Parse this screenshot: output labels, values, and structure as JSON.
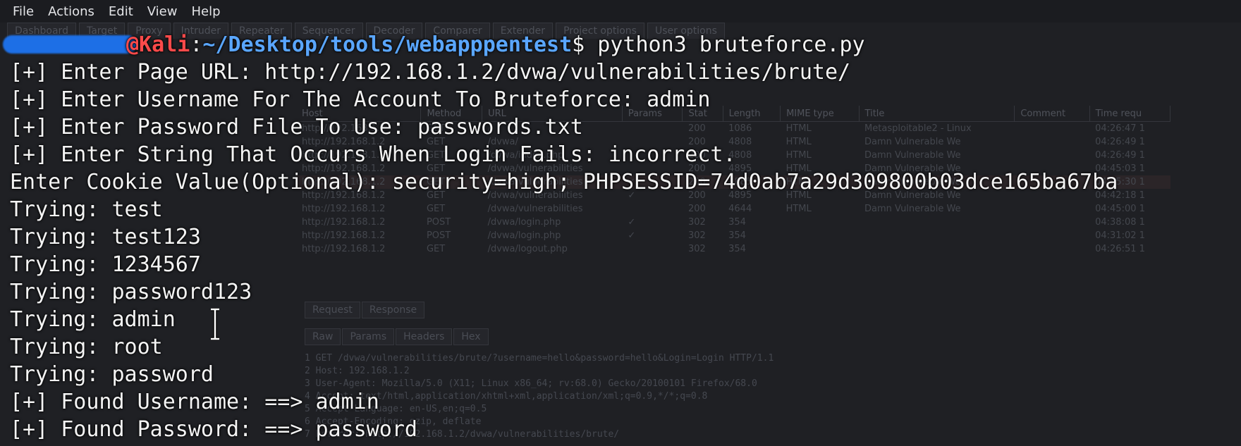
{
  "menubar": {
    "items": [
      "File",
      "Actions",
      "Edit",
      "View",
      "Help"
    ]
  },
  "terminal": {
    "prompt": {
      "user": "@Kali",
      "separator": ":",
      "path": "~/Desktop/tools/webapppentest",
      "symbol": "$",
      "command": "python3 bruteforce.py"
    },
    "lines": [
      "[+] Enter Page URL: http://192.168.1.2/dvwa/vulnerabilities/brute/",
      "[+] Enter Username For The Account To Bruteforce: admin",
      "[+] Enter Password File To Use: passwords.txt",
      "[+] Enter String That Occurs When Login Fails: incorrect.",
      "Enter Cookie Value(Optional): security=high; PHPSESSID=74d0ab7a29d309800b03dce165ba67ba",
      "Trying: test",
      "Trying: test123",
      "Trying: 1234567",
      "Trying: password123",
      "Trying: admin",
      "Trying: root",
      "Trying: password",
      "[+] Found Username: ==> admin",
      "[+] Found Password: ==> password"
    ]
  },
  "background_app": {
    "tabs": [
      "Dashboard",
      "Target",
      "Proxy",
      "Intruder",
      "Repeater",
      "Sequencer",
      "Decoder",
      "Comparer",
      "Extender",
      "Project options",
      "User options"
    ],
    "table_headers": [
      "Host",
      "Method",
      "URL",
      "Params",
      "Stat",
      "Length",
      "MIME type",
      "Title",
      "Comment",
      "Time requ"
    ],
    "table_rows": [
      [
        "http://192.168.1.2",
        "GET",
        "/",
        "",
        "200",
        "1086",
        "HTML",
        "Metasploitable2 - Linux",
        "",
        "04:26:47 1"
      ],
      [
        "http://192.168.1.2",
        "GET",
        "/dvwa/",
        "",
        "200",
        "4808",
        "HTML",
        "Damn Vulnerable We",
        "",
        "04:26:49 1"
      ],
      [
        "http://192.168.1.2",
        "GET",
        "/dvwa/index.php",
        "",
        "200",
        "4808",
        "HTML",
        "Damn Vulnerable We",
        "",
        "04:26:49 1"
      ],
      [
        "http://192.168.1.2",
        "GET",
        "/dvwa/vulnerabilities",
        "",
        "200",
        "4895",
        "HTML",
        "Damn Vulnerable We",
        "",
        "04:45:03 1"
      ],
      [
        "http://192.168.1.2",
        "GET",
        "/dvwa/vulnerabilities",
        "✓",
        "200",
        "4885",
        "HTML",
        "Damn Vulnerable We",
        "",
        "04:45:30 1"
      ],
      [
        "http://192.168.1.2",
        "GET",
        "/dvwa/vulnerabilities",
        "✓",
        "200",
        "4895",
        "HTML",
        "Damn Vulnerable We",
        "",
        "04:42:18 1"
      ],
      [
        "http://192.168.1.2",
        "GET",
        "/dvwa/vulnerabilities",
        "",
        "200",
        "4644",
        "HTML",
        "Damn Vulnerable We",
        "",
        "04:45:00 1"
      ],
      [
        "http://192.168.1.2",
        "POST",
        "/dvwa/login.php",
        "✓",
        "302",
        "354",
        "",
        "",
        "",
        "04:38:08 1"
      ],
      [
        "http://192.168.1.2",
        "POST",
        "/dvwa/login.php",
        "✓",
        "302",
        "354",
        "",
        "",
        "",
        "04:31:02 1"
      ],
      [
        "http://192.168.1.2",
        "GET",
        "/dvwa/logout.php",
        "",
        "302",
        "354",
        "",
        "",
        "",
        "04:26:51 1"
      ]
    ],
    "subtabs_a": [
      "Request",
      "Response"
    ],
    "subtabs_b": [
      "Raw",
      "Params",
      "Headers",
      "Hex"
    ],
    "request_lines": [
      "1 GET /dvwa/vulnerabilities/brute/?username=hello&password=hello&Login=Login HTTP/1.1",
      "2 Host: 192.168.1.2",
      "3 User-Agent: Mozilla/5.0 (X11; Linux x86_64; rv:68.0) Gecko/20100101 Firefox/68.0",
      "4 Accept: text/html,application/xhtml+xml,application/xml;q=0.9,*/*;q=0.8",
      "5 Accept-Language: en-US,en;q=0.5",
      "6 Accept-Encoding: gzip, deflate",
      "7 Referer: http://192.168.1.2/dvwa/vulnerabilities/brute/"
    ]
  },
  "colors": {
    "prompt_user": "#ff4a4a",
    "prompt_path": "#5aa6ff",
    "terminal_text": "#f4f4f4",
    "redaction": "#1d6fe6"
  },
  "icons": [
    "text-cursor-ibeam-icon"
  ]
}
